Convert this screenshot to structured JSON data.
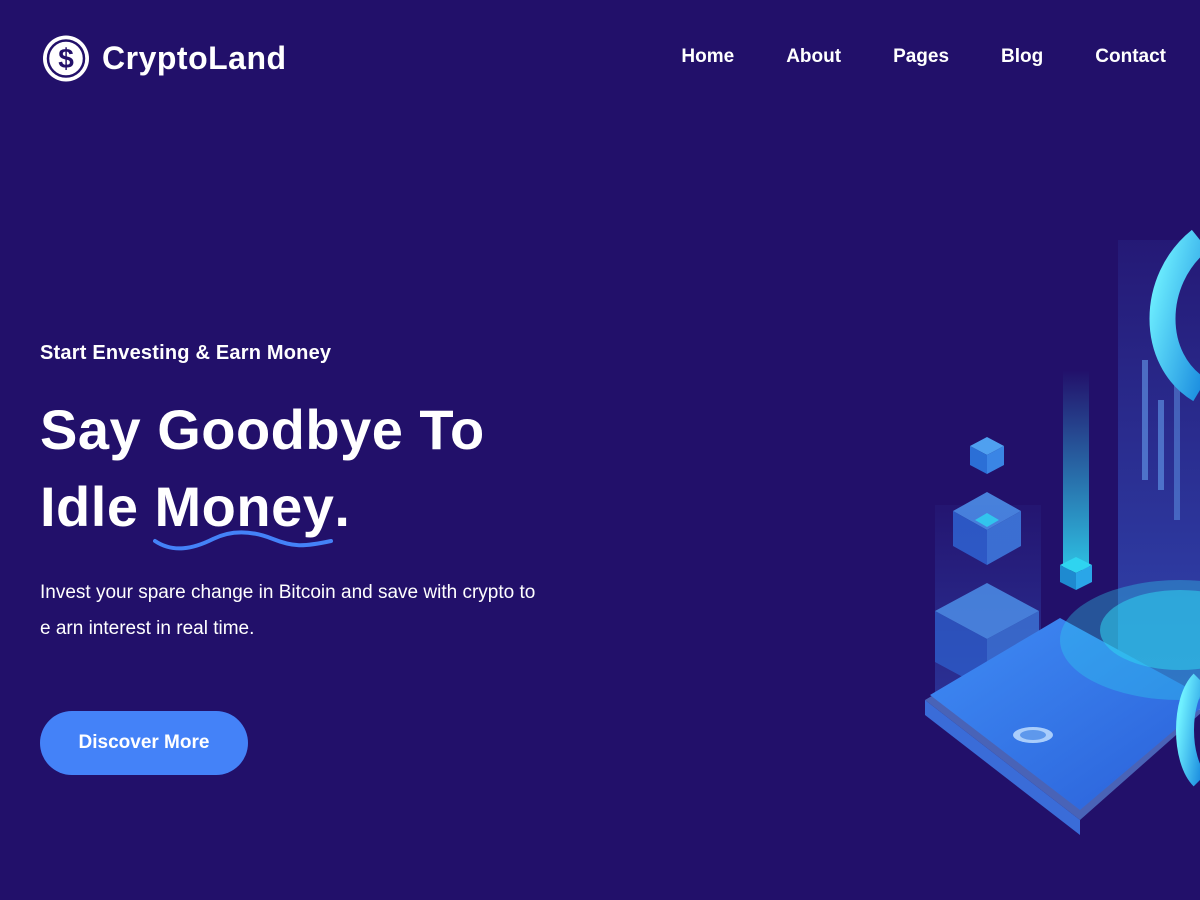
{
  "brand": {
    "name": "CryptoLand",
    "icon": "dollar-coin-icon"
  },
  "nav": {
    "items": [
      {
        "label": "Home"
      },
      {
        "label": "About"
      },
      {
        "label": "Pages"
      },
      {
        "label": "Blog"
      },
      {
        "label": "Contact"
      }
    ]
  },
  "hero": {
    "subtitle": "Start Envesting & Earn Money",
    "headline_line1": "Say Goodbye To",
    "headline_line2_prefix": "Idle ",
    "headline_line2_highlight": "Money",
    "headline_line2_suffix": ".",
    "description": "Invest your spare change in Bitcoin and save with crypto to e arn interest in real time.",
    "cta_label": "Discover More"
  },
  "colors": {
    "background": "#22106a",
    "accent": "#4482f8",
    "text": "#ffffff",
    "illustration_cyan": "#2fd4f0"
  }
}
